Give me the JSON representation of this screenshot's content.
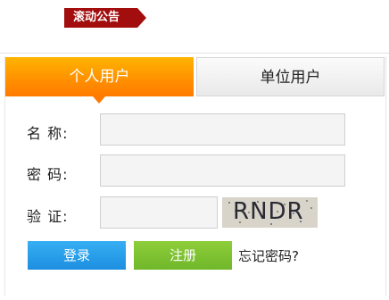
{
  "banner": {
    "label": "滚动公告"
  },
  "tabs": [
    {
      "label": "个人用户",
      "active": true
    },
    {
      "label": "单位用户",
      "active": false
    }
  ],
  "form": {
    "name_label": "名 称:",
    "password_label": "密 码:",
    "captcha_label": "验 证:",
    "name_value": "",
    "password_value": "",
    "captcha_value": "",
    "captcha_image_text": "RNDR"
  },
  "buttons": {
    "login": "登录",
    "register": "注册",
    "forgot": "忘记密码?"
  },
  "colors": {
    "banner": "#a20d0d",
    "active_tab": "#ff8f00",
    "login": "#2a9ee8",
    "register": "#7fc232"
  }
}
